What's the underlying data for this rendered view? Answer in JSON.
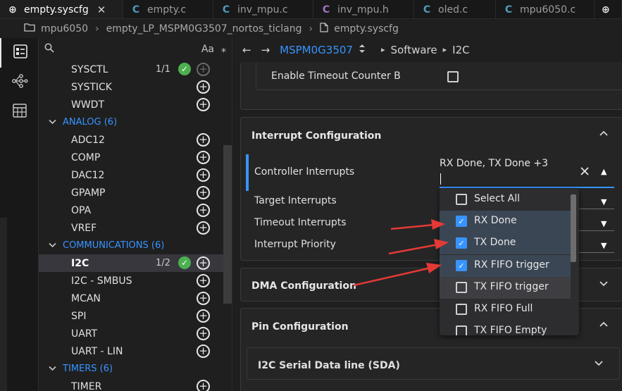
{
  "tabs": [
    {
      "label": "empty.syscfg",
      "icon": "globe-icon",
      "glyph": "⊕",
      "active": true,
      "close": "✕"
    },
    {
      "label": "empty.c",
      "icon": "c-file-icon",
      "glyph": "C"
    },
    {
      "label": "inv_mpu.c",
      "icon": "c-file-icon",
      "glyph": "C"
    },
    {
      "label": "inv_mpu.h",
      "icon": "h-file-icon",
      "glyph": "C"
    },
    {
      "label": "oled.c",
      "icon": "c-file-icon",
      "glyph": "C"
    },
    {
      "label": "mpu6050.c",
      "icon": "c-file-icon",
      "glyph": "C"
    },
    {
      "label": "",
      "icon": "globe-icon",
      "glyph": "⊕"
    }
  ],
  "breadcrumb": {
    "folder": "mpu6050",
    "project": "empty_LP_MSPM0G3507_nortos_ticlang",
    "file": "empty.syscfg",
    "sep": "›"
  },
  "tree": {
    "search_glyph": "🔍",
    "aa": "Aa",
    "star": "⁎",
    "rows": [
      {
        "label": "SYSCTL",
        "type": "item",
        "count": "1/1",
        "ok": true,
        "plus_dim": true
      },
      {
        "label": "SYSTICK",
        "type": "item"
      },
      {
        "label": "WWDT",
        "type": "item"
      },
      {
        "label": "ANALOG (6)",
        "type": "cat"
      },
      {
        "label": "ADC12",
        "type": "item"
      },
      {
        "label": "COMP",
        "type": "item"
      },
      {
        "label": "DAC12",
        "type": "item"
      },
      {
        "label": "GPAMP",
        "type": "item"
      },
      {
        "label": "OPA",
        "type": "item"
      },
      {
        "label": "VREF",
        "type": "item"
      },
      {
        "label": "COMMUNICATIONS (6)",
        "type": "cat"
      },
      {
        "label": "I2C",
        "type": "item",
        "count": "1/2",
        "ok": true,
        "selected": true
      },
      {
        "label": "I2C - SMBUS",
        "type": "item"
      },
      {
        "label": "MCAN",
        "type": "item"
      },
      {
        "label": "SPI",
        "type": "item"
      },
      {
        "label": "UART",
        "type": "item"
      },
      {
        "label": "UART - LIN",
        "type": "item"
      },
      {
        "label": "TIMERS (6)",
        "type": "cat"
      },
      {
        "label": "TIMER",
        "type": "item"
      }
    ]
  },
  "nav": {
    "back": "←",
    "forward": "→",
    "device": "MSPM0G3507",
    "path1": "Software",
    "path2": "I2C"
  },
  "timeout_b": {
    "label": "Enable Timeout Counter B",
    "checked": false
  },
  "interrupt": {
    "title": "Interrupt Configuration",
    "controller_label": "Controller Interrupts",
    "controller_value": "RX Done, TX Done +3",
    "clear": "✕",
    "target_label": "Target Interrupts",
    "timeout_label": "Timeout Interrupts",
    "priority_label": "Interrupt Priority"
  },
  "dma": {
    "title": "DMA Configuration"
  },
  "pin": {
    "title": "Pin Configuration",
    "sda": "I2C Serial Data line (SDA)"
  },
  "options": [
    {
      "label": "Select All",
      "checked": false
    },
    {
      "label": "RX Done",
      "checked": true
    },
    {
      "label": "TX Done",
      "checked": true
    },
    {
      "label": "RX FIFO trigger",
      "checked": true
    },
    {
      "label": "TX FIFO trigger",
      "checked": false
    },
    {
      "label": "RX FIFO Full",
      "checked": false
    },
    {
      "label": "TX FIFO Empty",
      "checked": false
    }
  ],
  "colors": {
    "accent": "#3794ff",
    "ok": "#4caf50",
    "arrow": "#e53935"
  }
}
